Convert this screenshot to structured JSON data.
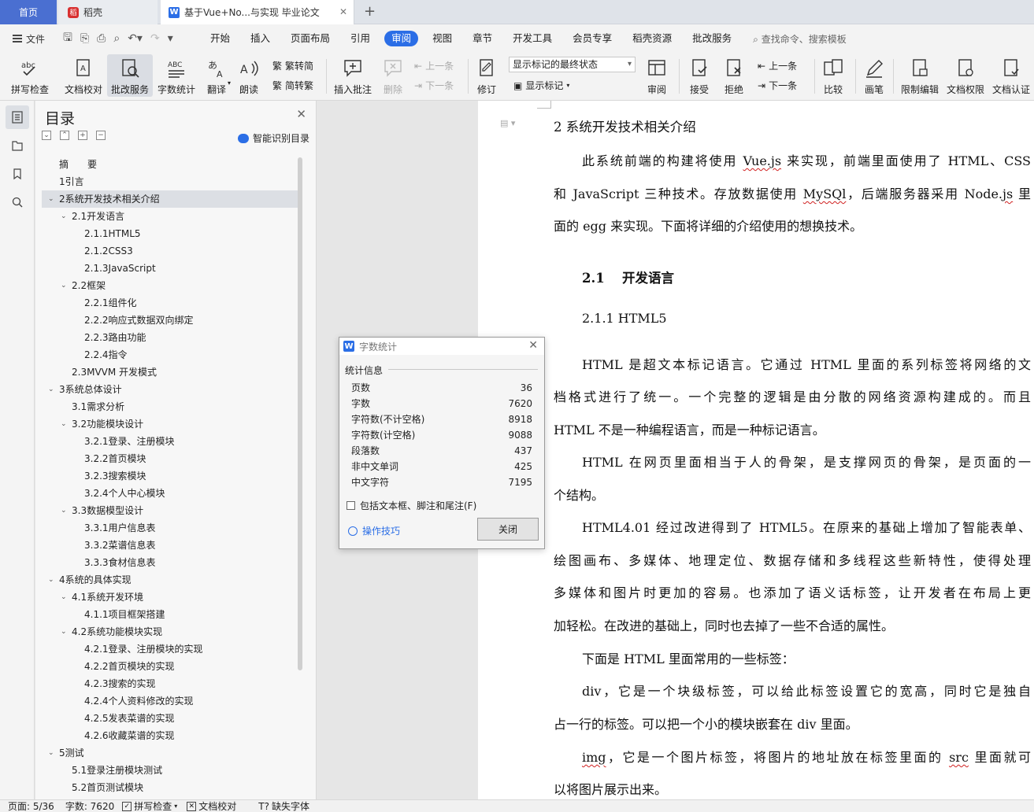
{
  "tabs": {
    "home": "首页",
    "daoke": "稻壳",
    "doc": "基于Vue+No...与实现 毕业论文"
  },
  "menu": {
    "file": "文件",
    "items": [
      "开始",
      "插入",
      "页面布局",
      "引用",
      "审阅",
      "视图",
      "章节",
      "开发工具",
      "会员专享",
      "稻壳资源",
      "批改服务"
    ],
    "active_index": 4,
    "search": "查找命令、搜索模板"
  },
  "ribbon": {
    "spell": "拼写检查",
    "proofread": "文档校对",
    "correct": "批改服务",
    "wordcount": "字数统计",
    "translate": "翻译",
    "read": "朗读",
    "t2s": "繁转简",
    "s2t": "简转繁",
    "insert_comment": "插入批注",
    "delete": "删除",
    "prev": "上一条",
    "next": "下一条",
    "revise": "修订",
    "markup_select": "显示标记的最终状态",
    "show_markup": "显示标记",
    "review": "审阅",
    "accept": "接受",
    "reject": "拒绝",
    "prev2": "上一条",
    "next2": "下一条",
    "compare": "比较",
    "pen": "画笔",
    "restrict": "限制编辑",
    "permission": "文档权限",
    "certify": "文档认证"
  },
  "toc": {
    "title": "目录",
    "smart": "智能识别目录",
    "items": [
      {
        "text": "摘　　要",
        "level": 1,
        "caret": ""
      },
      {
        "text": "1引言",
        "level": 1,
        "caret": ""
      },
      {
        "text": "2系统开发技术相关介绍",
        "level": 1,
        "caret": "v",
        "selected": true
      },
      {
        "text": "2.1开发语言",
        "level": 2,
        "caret": "v"
      },
      {
        "text": "2.1.1HTML5",
        "level": 3,
        "caret": ""
      },
      {
        "text": "2.1.2CSS3",
        "level": 3,
        "caret": ""
      },
      {
        "text": "2.1.3JavaScript",
        "level": 3,
        "caret": ""
      },
      {
        "text": "2.2框架",
        "level": 2,
        "caret": "v"
      },
      {
        "text": "2.2.1组件化",
        "level": 3,
        "caret": ""
      },
      {
        "text": "2.2.2响应式数据双向绑定",
        "level": 3,
        "caret": ""
      },
      {
        "text": "2.2.3路由功能",
        "level": 3,
        "caret": ""
      },
      {
        "text": "2.2.4指令",
        "level": 3,
        "caret": ""
      },
      {
        "text": "2.3MVVM 开发模式",
        "level": 2,
        "caret": ""
      },
      {
        "text": "3系统总体设计",
        "level": 1,
        "caret": "v"
      },
      {
        "text": "3.1需求分析",
        "level": 2,
        "caret": ""
      },
      {
        "text": "3.2功能模块设计",
        "level": 2,
        "caret": "v"
      },
      {
        "text": "3.2.1登录、注册模块",
        "level": 3,
        "caret": ""
      },
      {
        "text": "3.2.2首页模块",
        "level": 3,
        "caret": ""
      },
      {
        "text": "3.2.3搜索模块",
        "level": 3,
        "caret": ""
      },
      {
        "text": "3.2.4个人中心模块",
        "level": 3,
        "caret": ""
      },
      {
        "text": "3.3数据模型设计",
        "level": 2,
        "caret": "v"
      },
      {
        "text": "3.3.1用户信息表",
        "level": 3,
        "caret": ""
      },
      {
        "text": "3.3.2菜谱信息表",
        "level": 3,
        "caret": ""
      },
      {
        "text": "3.3.3食材信息表",
        "level": 3,
        "caret": ""
      },
      {
        "text": "4系统的具体实现",
        "level": 1,
        "caret": "v"
      },
      {
        "text": "4.1系统开发环境",
        "level": 2,
        "caret": "v"
      },
      {
        "text": "4.1.1项目框架搭建",
        "level": 3,
        "caret": ""
      },
      {
        "text": "4.2系统功能模块实现",
        "level": 2,
        "caret": "v"
      },
      {
        "text": "4.2.1登录、注册模块的实现",
        "level": 3,
        "caret": ""
      },
      {
        "text": "4.2.2首页模块的实现",
        "level": 3,
        "caret": ""
      },
      {
        "text": "4.2.3搜索的实现",
        "level": 3,
        "caret": ""
      },
      {
        "text": "4.2.4个人资料修改的实现",
        "level": 3,
        "caret": ""
      },
      {
        "text": "4.2.5发表菜谱的实现",
        "level": 3,
        "caret": ""
      },
      {
        "text": "4.2.6收藏菜谱的实现",
        "level": 3,
        "caret": ""
      },
      {
        "text": "5测试",
        "level": 1,
        "caret": "v"
      },
      {
        "text": "5.1登录注册模块测试",
        "level": 2,
        "caret": ""
      },
      {
        "text": "5.2首页测试模块",
        "level": 2,
        "caret": ""
      }
    ]
  },
  "document": {
    "h2": "2 系统开发技术相关介绍",
    "p1": [
      {
        "t": "此系统前端的构建将使用 ",
        "wv": false
      },
      {
        "t": "Vue.js",
        "wv": true
      },
      {
        "t": " 来实现，前端里面使用了 HTML、CSS",
        "wv": false
      }
    ],
    "p1b": [
      {
        "t": "和 JavaScript 三种技术。存放数据使用 ",
        "wv": false
      },
      {
        "t": "MySQl",
        "wv": true
      },
      {
        "t": "，后端服务器采用 Node.",
        "wv": false
      },
      {
        "t": "js",
        "wv": true
      },
      {
        "t": " 里",
        "wv": false
      }
    ],
    "p1c": "面的 egg 来实现。下面将详细的介绍使用的想换技术。",
    "h3": "2.1　 开发语言",
    "h4": "2.1.1  HTML5",
    "lines": [
      "HTML 是超文本标记语言。它通过 HTML 里面的系列标签将网络的文",
      "档格式进行了统一。一个完整的逻辑是由分散的网络资源构建成的。而且",
      "HTML 不是一种编程语言，而是一种标记语言。",
      "HTML 在网页里面相当于人的骨架，是支撑网页的骨架，是页面的一",
      "个结构。",
      "HTML4.01 经过改进得到了 HTML5。在原来的基础上增加了智能表单、",
      "绘图画布、多媒体、地理定位、数据存储和多线程这些新特性，使得处理",
      "多媒体和图片时更加的容易。也添加了语义话标签，让开发者在布局上更",
      "加轻松。在改进的基础上，同时也去掉了一些不合适的属性。",
      "下面是 HTML 里面常用的一些标签：",
      "div，它是一个块级标签，可以给此标签设置它的宽高，同时它是独自",
      "占一行的标签。可以把一个小的模块嵌套在 div 里面。"
    ],
    "img_line": [
      {
        "t": "img",
        "wv": true
      },
      {
        "t": "，它是一个图片标签，将图片的地址放在标签里面的 ",
        "wv": false
      },
      {
        "t": "src",
        "wv": true
      },
      {
        "t": " 里面就可",
        "wv": false
      }
    ],
    "last_line": "以将图片展示出来。"
  },
  "dialog": {
    "title": "字数统计",
    "section": "统计信息",
    "rows": [
      {
        "label": "页数",
        "value": "36"
      },
      {
        "label": "字数",
        "value": "7620"
      },
      {
        "label": "字符数(不计空格)",
        "value": "8918"
      },
      {
        "label": "字符数(计空格)",
        "value": "9088"
      },
      {
        "label": "段落数",
        "value": "437"
      },
      {
        "label": "非中文单词",
        "value": "425"
      },
      {
        "label": "中文字符",
        "value": "7195"
      }
    ],
    "checkbox": "包括文本框、脚注和尾注(F)",
    "tips": "操作技巧",
    "close": "关闭"
  },
  "status": {
    "page": "页面: 5/36",
    "words": "字数: 7620",
    "spell": "拼写检查",
    "proof": "文档校对",
    "missing_font": "缺失字体"
  }
}
